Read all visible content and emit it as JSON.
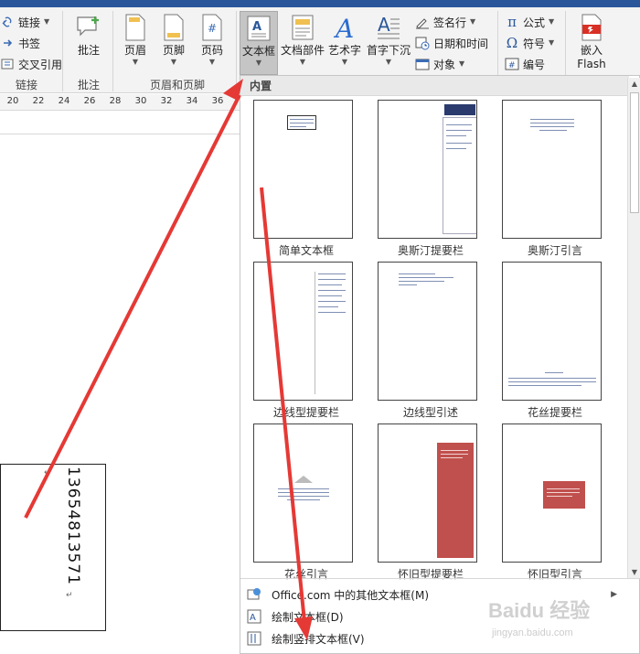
{
  "ribbon": {
    "links_group": {
      "label": "链接",
      "items": [
        {
          "label": "链接",
          "icon": "link-icon"
        },
        {
          "label": "书签",
          "icon": "bookmark-icon"
        },
        {
          "label": "交叉引用",
          "icon": "cross-reference-icon"
        }
      ]
    },
    "comments_group": {
      "label": "批注",
      "button": "批注"
    },
    "header_footer_group": {
      "label": "页眉和页脚",
      "buttons": [
        "页眉",
        "页脚",
        "页码"
      ]
    },
    "text_group": {
      "buttons": [
        "文本框",
        "文档部件",
        "艺术字",
        "首字下沉"
      ],
      "small": [
        "签名行",
        "日期和时间",
        "对象"
      ]
    },
    "symbols_group": {
      "small": [
        "公式",
        "符号",
        "编号"
      ]
    },
    "flash_group": {
      "label_line1": "嵌入",
      "label_line2": "Flash"
    }
  },
  "ruler": {
    "ticks": [
      "20",
      "22",
      "24",
      "26",
      "28",
      "30",
      "32",
      "34",
      "36"
    ]
  },
  "document": {
    "vertical_text": "13654813571"
  },
  "gallery": {
    "header": "内置",
    "tiles": [
      {
        "caption": "简单文本框"
      },
      {
        "caption": "奥斯汀提要栏"
      },
      {
        "caption": "奥斯汀引言"
      },
      {
        "caption": "边线型提要栏"
      },
      {
        "caption": "边线型引述"
      },
      {
        "caption": "花丝提要栏"
      },
      {
        "caption": "花丝引言"
      },
      {
        "caption": "怀旧型提要栏"
      },
      {
        "caption": "怀旧型引言"
      }
    ],
    "menu": [
      {
        "label": "Office.com 中的其他文本框(M)",
        "icon": "office-icon",
        "has_submenu": true
      },
      {
        "label": "绘制文本框(D)",
        "icon": "draw-textbox-icon",
        "has_submenu": false
      },
      {
        "label": "绘制竖排文本框(V)",
        "icon": "draw-vertical-textbox-icon",
        "has_submenu": false
      }
    ]
  },
  "watermark": {
    "logo": "Baidu 经验",
    "url": "jingyan.baidu.com"
  },
  "colors": {
    "accent_red": "#e53935",
    "ribbon_blue": "#2b579a",
    "tile_red": "#c0504d"
  }
}
